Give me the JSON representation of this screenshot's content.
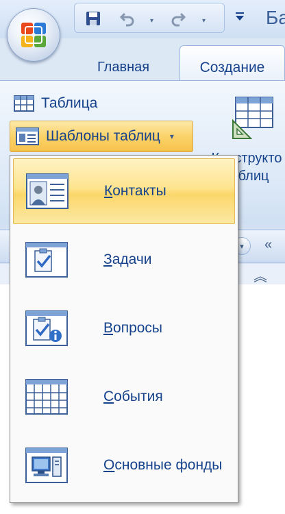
{
  "app": {
    "title_partial": "Ба"
  },
  "quick_access": {
    "undo_arrow": "▾",
    "redo_arrow": "▾",
    "customize": "▾"
  },
  "tabs": [
    {
      "label": "Главная"
    },
    {
      "label": "Создание",
      "active": true
    }
  ],
  "ribbon": {
    "table_label": "Таблица",
    "templates_label": "Шаблоны таблиц",
    "templates_arrow": "▾",
    "designer_label_line1": "Конструкто",
    "designer_label_line2": "таблиц"
  },
  "menu": {
    "items": [
      {
        "accel": "К",
        "rest": "онтакты",
        "icon": "contacts-icon",
        "hovered": true
      },
      {
        "accel": "З",
        "rest": "адачи",
        "icon": "tasks-icon"
      },
      {
        "accel": "В",
        "rest": "опросы",
        "icon": "issues-icon"
      },
      {
        "accel": "С",
        "rest": "обытия",
        "icon": "events-icon"
      },
      {
        "accel": "О",
        "rest": "сновные фонды",
        "icon": "assets-icon"
      }
    ]
  },
  "nav_pane": {
    "dropdown": "▾",
    "collapse": "«",
    "section_toggle": "︽"
  },
  "colors": {
    "accent_text": "#15428b",
    "hover_fill": "#fbd76b",
    "ribbon_bg": "#dde9f7"
  }
}
